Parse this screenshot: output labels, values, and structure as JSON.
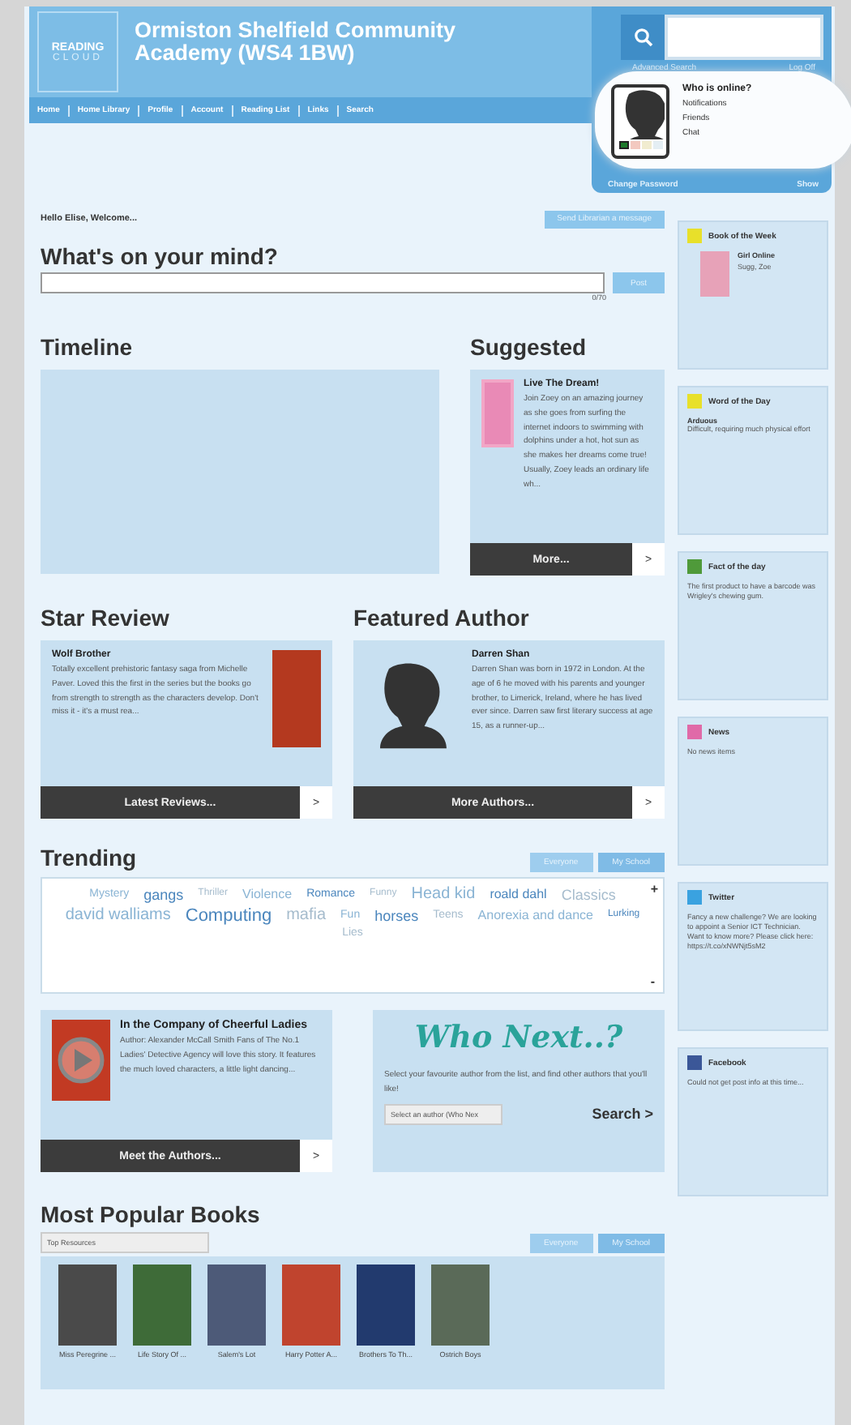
{
  "header": {
    "logo": [
      "READING",
      "CLOUD"
    ],
    "school": "Ormiston Shelfield Community Academy (WS4 1BW)",
    "links": [
      "Advanced Search",
      "Log Off"
    ]
  },
  "nav": [
    "Home",
    "Home Library",
    "Profile",
    "Account",
    "Reading List",
    "Links",
    "Search"
  ],
  "online_panel": {
    "title": "Who is online?",
    "items": [
      "Notifications",
      "Friends",
      "Chat"
    ],
    "status_dots": [
      {
        "color": "#1d7a2b",
        "selected": true
      },
      {
        "color": "#f3c9c0",
        "selected": false
      },
      {
        "color": "#f1ecd0",
        "selected": false
      },
      {
        "color": "#e4eef4",
        "selected": false
      }
    ],
    "footer_links": [
      "Change Password",
      "Show"
    ]
  },
  "greeting": "Hello Elise, Welcome...",
  "message_button": "Send Librarian a message",
  "post": {
    "heading": "What's on your mind?",
    "button": "Post",
    "counter": "0/70"
  },
  "timeline": {
    "heading": "Timeline"
  },
  "suggested": {
    "heading": "Suggested",
    "title": "Live The Dream!",
    "text": "Join Zoey on an amazing journey as she goes from surfing the internet indoors to swimming with dolphins under a hot, hot sun as she makes her dreams come true! Usually, Zoey leads an ordinary life wh...",
    "button": "More...",
    "arrow": ">"
  },
  "star_review": {
    "heading": "Star Review",
    "title": "Wolf Brother",
    "text": "Totally excellent prehistoric fantasy saga from Michelle Paver. Loved this the first in the series but the books go from strength to strength as the characters develop. Don't miss it - it's a must rea...",
    "button": "Latest Reviews...",
    "arrow": ">"
  },
  "featured_author": {
    "heading": "Featured Author",
    "title": "Darren Shan",
    "text": "Darren Shan was born in 1972 in London. At the age of 6 he moved with his parents and younger brother, to Limerick, Ireland, where he has lived ever since. Darren saw first literary success at age 15, as a runner-up...",
    "button": "More Authors...",
    "arrow": ">"
  },
  "trending": {
    "heading": "Trending",
    "filters": [
      "Everyone",
      "My School"
    ],
    "scroll": [
      "+",
      "-"
    ],
    "words": [
      "Mystery",
      "gangs",
      "Thriller",
      "Violence",
      "Romance",
      "Funny",
      "Head kid",
      "roald dahl",
      "Classics",
      "david walliams",
      "Computing",
      "mafia",
      "Fun",
      "horses",
      "Teens",
      "Anorexia and dance",
      "Lurking",
      "Lies"
    ]
  },
  "video": {
    "title": "In the Company of Cheerful Ladies",
    "text": "Author: Alexander McCall Smith Fans of The No.1 Ladies' Detective Agency will love this story. It features the much loved characters, a little light dancing...",
    "button": "Meet the Authors...",
    "arrow": ">"
  },
  "who_next": {
    "logo": "Who Next..?",
    "text": "Select your favourite author from the list, and find other authors that you'll like!",
    "select": "Select an author (Who Nex",
    "button": "Search >"
  },
  "popular": {
    "heading": "Most Popular Books",
    "select": "Top Resources",
    "filters": [
      "Everyone",
      "My School"
    ],
    "books": [
      {
        "title": "Miss Peregrine ..."
      },
      {
        "title": "Life Story Of ..."
      },
      {
        "title": "Salem's Lot"
      },
      {
        "title": "Harry Potter A..."
      },
      {
        "title": "Brothers To Th..."
      },
      {
        "title": "Ostrich Boys"
      }
    ]
  },
  "sidebar": [
    {
      "title": "Book of the Week",
      "color": "#e8e02a",
      "book": "Girl Online",
      "author": "Sugg, Zoe"
    },
    {
      "title": "Word of the Day",
      "color": "#e8e02a",
      "word": "Arduous",
      "text": "Difficult, requiring much physical effort"
    },
    {
      "title": "Fact of the day",
      "color": "#4f9a3a",
      "text": "The first product to have a barcode was Wrigley's chewing gum."
    },
    {
      "title": "News",
      "color": "#e06aa8",
      "text": "No news items"
    },
    {
      "title": "Twitter",
      "color": "#3aa2e0",
      "text": "Fancy a new challenge? We are looking to appoint a Senior ICT Technician. Want to know more? Please click here: https://t.co/xNWNjt5sM2"
    },
    {
      "title": "Facebook",
      "color": "#3b5798",
      "text": "Could not get post info at this time..."
    }
  ]
}
